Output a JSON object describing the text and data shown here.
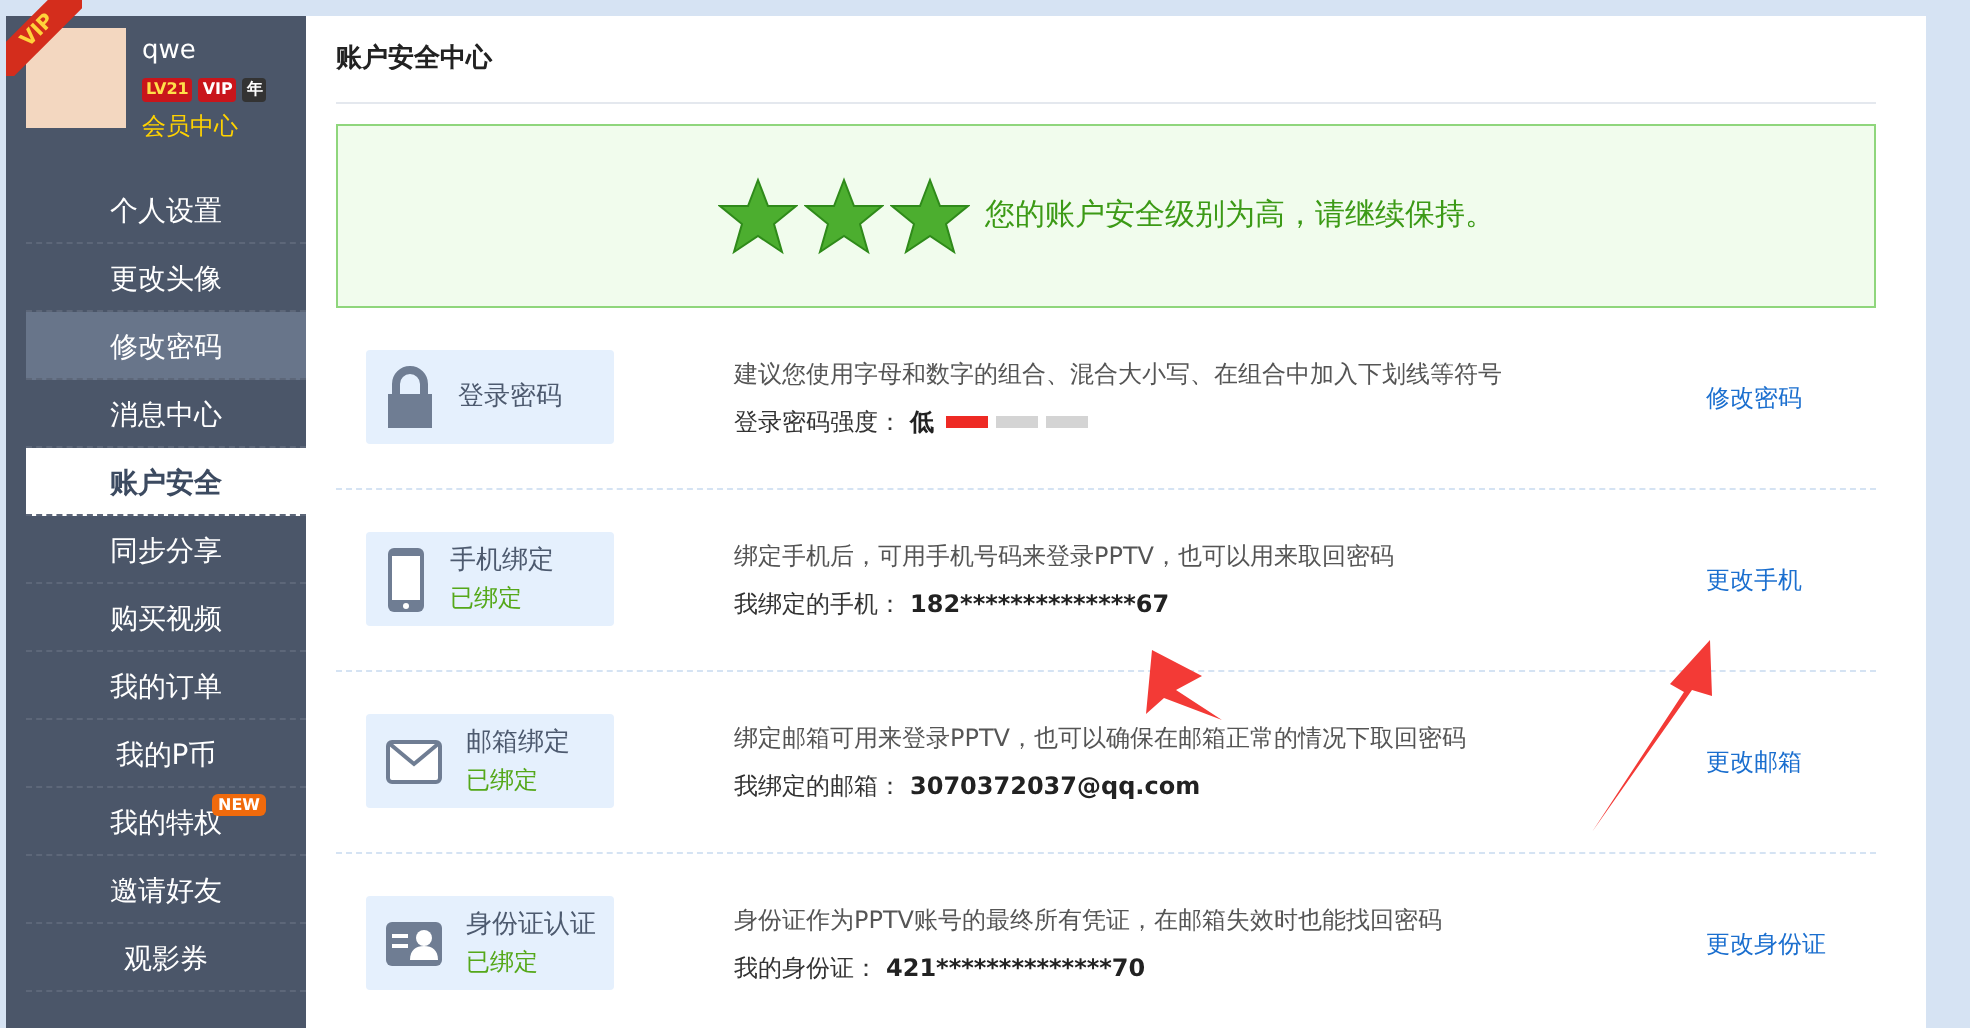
{
  "user": {
    "name": "qwe",
    "level_badge": "LV21",
    "vip_badge": "VIP",
    "year_badge": "年",
    "member_link": "会员中心",
    "corner_ribbon": "VIP"
  },
  "sidebar": {
    "items": [
      {
        "label": "个人设置",
        "selected": false,
        "hovered": false
      },
      {
        "label": "更改头像",
        "selected": false,
        "hovered": false
      },
      {
        "label": "修改密码",
        "selected": false,
        "hovered": true
      },
      {
        "label": "消息中心",
        "selected": false,
        "hovered": false
      },
      {
        "label": "账户安全",
        "selected": true,
        "hovered": false
      },
      {
        "label": "同步分享",
        "selected": false,
        "hovered": false
      },
      {
        "label": "购买视频",
        "selected": false,
        "hovered": false
      },
      {
        "label": "我的订单",
        "selected": false,
        "hovered": false
      },
      {
        "label": "我的P币",
        "selected": false,
        "hovered": false
      },
      {
        "label": "我的特权",
        "selected": false,
        "hovered": false,
        "badge": "NEW"
      },
      {
        "label": "邀请好友",
        "selected": false,
        "hovered": false
      },
      {
        "label": "观影券",
        "selected": false,
        "hovered": false
      }
    ]
  },
  "page_title": "账户安全中心",
  "security_banner": {
    "stars": 3,
    "message": "您的账户安全级别为高，请继续保持。"
  },
  "items": [
    {
      "kind": "lock",
      "title": "登录密码",
      "description": "建议您使用字母和数字的组合、混合大小写、在组合中加入下划线等符号",
      "detail_label": "登录密码强度：",
      "detail_value": "低",
      "level": 0.33,
      "action": "修改密码"
    },
    {
      "kind": "phone",
      "title": "手机绑定",
      "status": "已绑定",
      "description": "绑定手机后，可用手机号码来登录PPTV，也可以用来取回密码",
      "detail_label": "我绑定的手机：",
      "detail_value": "182**************67",
      "action": "更改手机"
    },
    {
      "kind": "mail",
      "title": "邮箱绑定",
      "status": "已绑定",
      "description": "绑定邮箱可用来登录PPTV，也可以确保在邮箱正常的情况下取回密码",
      "detail_label": "我绑定的邮箱：",
      "detail_value": "3070372037@qq.com",
      "action": "更改邮箱"
    },
    {
      "kind": "idcard",
      "title": "身份证认证",
      "status": "已绑定",
      "description": "身份证作为PPTV账号的最终所有凭证，在邮箱失效时也能找回密码",
      "detail_label": "我的身份证：",
      "detail_value": "421**************70",
      "action": "更改身份证"
    }
  ]
}
